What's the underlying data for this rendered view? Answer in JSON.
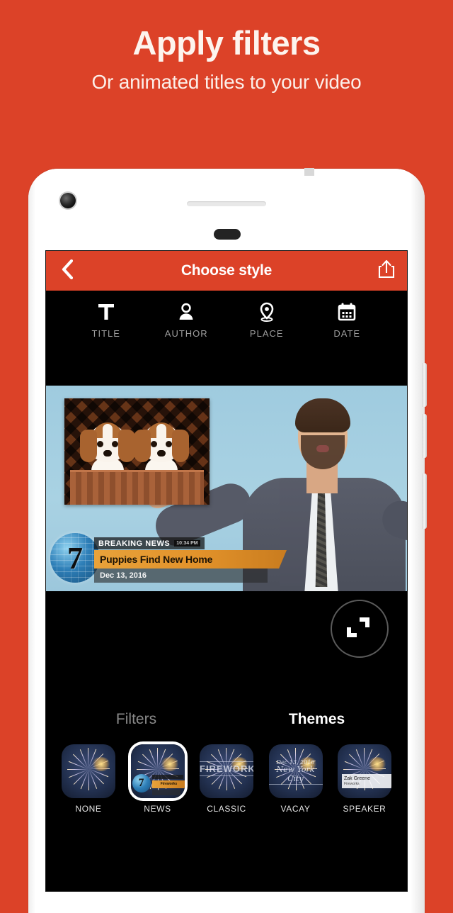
{
  "promo": {
    "title": "Apply filters",
    "subtitle": "Or animated titles to your video",
    "background_color": "#DC4228"
  },
  "app": {
    "header": {
      "back_icon": "chevron-left-icon",
      "title": "Choose style",
      "share_icon": "share-upload-icon",
      "background_color": "#DC4228"
    },
    "tabs": [
      {
        "label": "TITLE",
        "icon": "text-t-icon"
      },
      {
        "label": "AUTHOR",
        "icon": "person-icon"
      },
      {
        "label": "PLACE",
        "icon": "map-pin-icon"
      },
      {
        "label": "DATE",
        "icon": "calendar-icon"
      }
    ],
    "preview": {
      "news_overlay": {
        "channel_number": "7",
        "kicker": "BREAKING NEWS",
        "timestamp": "10:34 PM",
        "headline": "Puppies Find New Home",
        "date": "Dec 13, 2016",
        "bar_color": "#E2922A"
      },
      "expand_icon": "fullscreen-expand-icon"
    },
    "mode_tabs": {
      "filters_label": "Filters",
      "themes_label": "Themes",
      "active": "Themes"
    },
    "themes": [
      {
        "label": "NONE",
        "selected": false,
        "overlay": "none"
      },
      {
        "label": "NEWS",
        "selected": true,
        "overlay": "news"
      },
      {
        "label": "CLASSIC",
        "selected": false,
        "overlay": "classic",
        "text": "FIREWORKS"
      },
      {
        "label": "VACAY",
        "selected": false,
        "overlay": "vacay",
        "date": "Dec 13, 2016",
        "place": "New York City"
      },
      {
        "label": "SPEAKER",
        "selected": false,
        "overlay": "speaker",
        "name": "Zak Greene",
        "role": "Fireworks"
      }
    ]
  }
}
